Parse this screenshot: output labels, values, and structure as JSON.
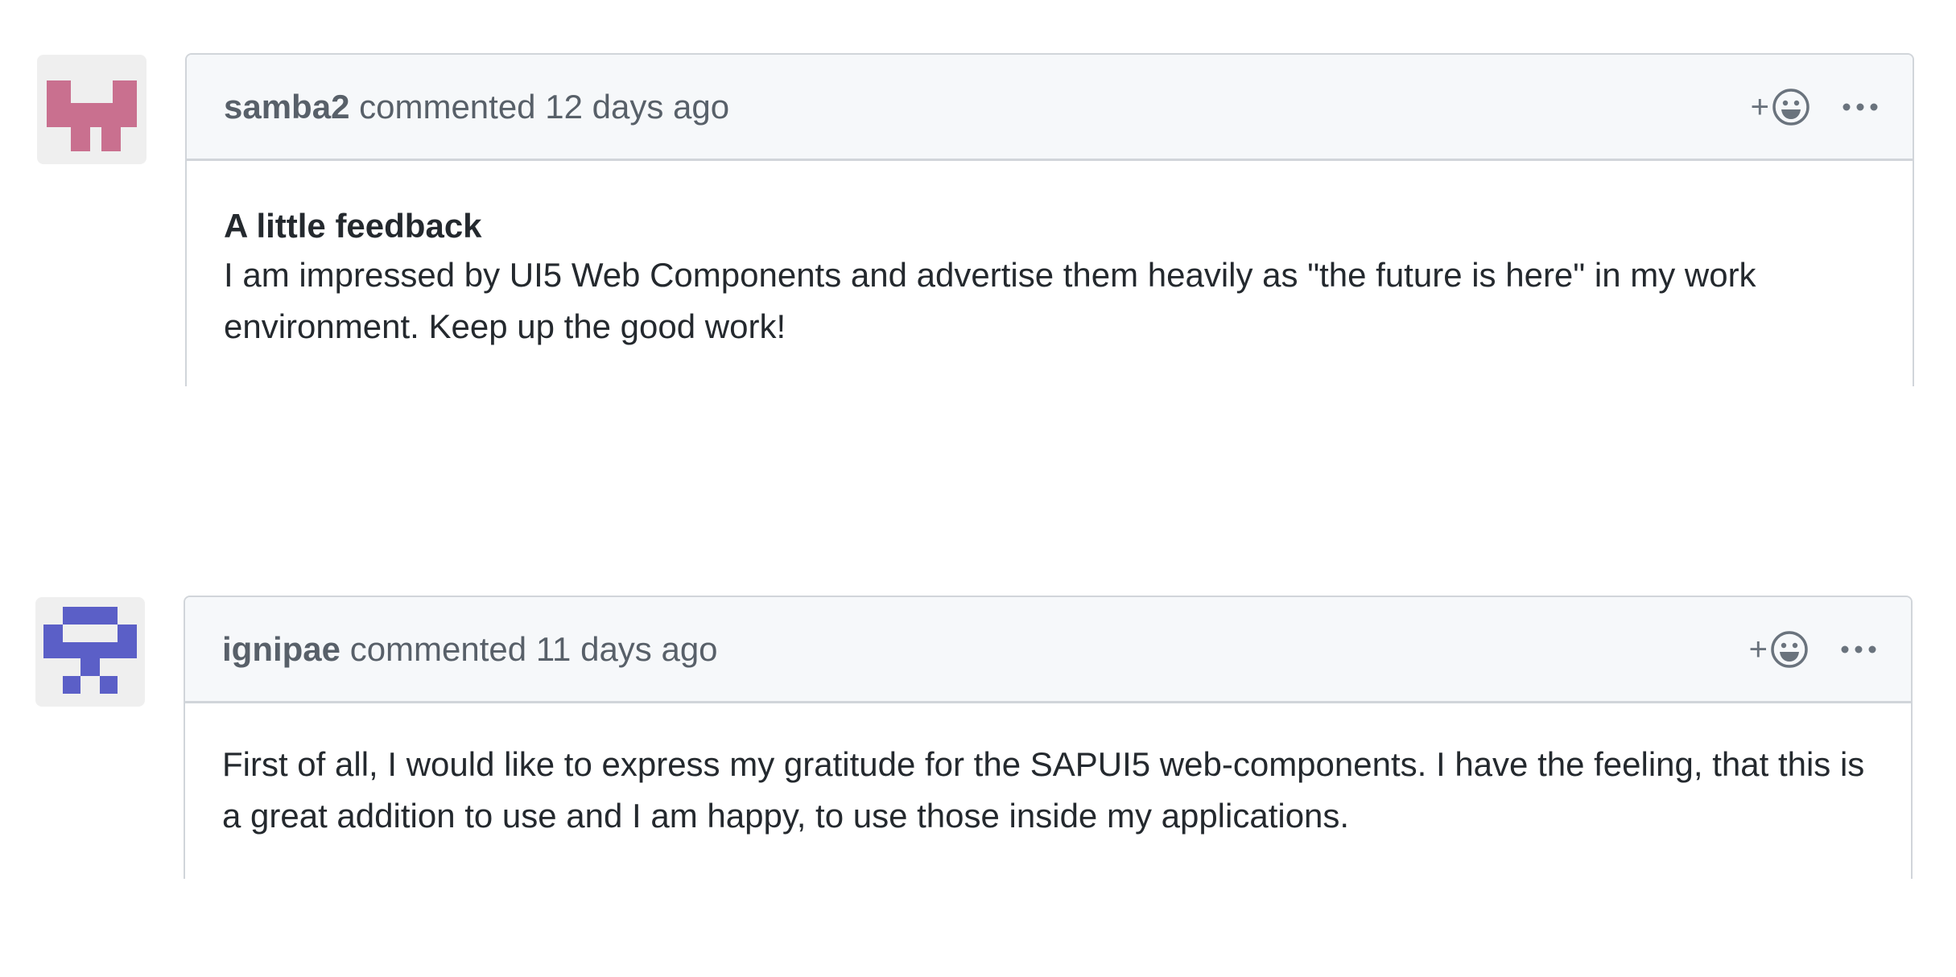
{
  "comments": [
    {
      "author": "samba2",
      "action": "commented",
      "time": "12 days ago",
      "heading": "A little feedback",
      "body": "I am impressed by UI5 Web Components and advertise them heavily as \"the future is here\" in my work environment. Keep up the good work!",
      "avatar_color": "#c9708f",
      "reaction_icon": "smiley-plus-icon",
      "menu_icon": "kebab-horizontal-icon"
    },
    {
      "author": "ignipae",
      "action": "commented",
      "time": "11 days ago",
      "heading": "",
      "body": "First of all, I would like to express my gratitude for the SAPUI5 web-components. I have the feeling, that this is a great addition to use and I am happy, to use those inside my applications.",
      "avatar_color": "#5b5fc7",
      "reaction_icon": "smiley-plus-icon",
      "menu_icon": "kebab-horizontal-icon"
    }
  ],
  "colors": {
    "border": "#d1d5da",
    "header_bg": "#f6f8fa",
    "muted_text": "#586069",
    "body_text": "#24292e"
  }
}
